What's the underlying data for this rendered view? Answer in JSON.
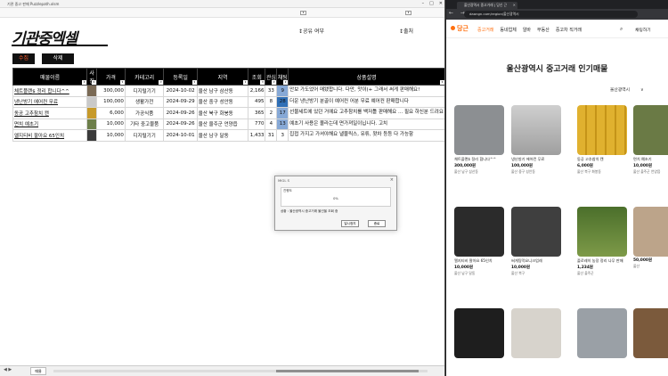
{
  "excel": {
    "title": "기관 중고 판매 Puzzlepath.xlsm",
    "window_buttons": [
      "–",
      "□",
      "✕"
    ],
    "logo": "기관중엑셀",
    "header_left": "↕공유 여부",
    "header_right": "↕출처",
    "btn_fetch": "수집",
    "btn_delete": "삭제",
    "columns": [
      "매물이름",
      "사진",
      "가격",
      "카테고리",
      "등록일",
      "지역",
      "조회",
      "관심",
      "채팅",
      "상품설명"
    ],
    "rows": [
      {
        "name": "체트플랜$ 정리 합니다^^",
        "price": "300,000",
        "category": "디지털기기",
        "date": "2024-10-02",
        "region": "울산 남구 삼산동",
        "views": "2,166",
        "likes": "33",
        "chats": "9",
        "desc": "안보 가도었어 매됐합니다. 다만, 맛이(+ 그래서 써게 판매해요!"
      },
      {
        "name": "냉난방기 에어컨 무료",
        "price": "100,000",
        "category": "생활가전",
        "date": "2024-09-29",
        "region": "울산 중구 성안동",
        "views": "495",
        "likes": "8",
        "chats": "28",
        "desc": "더운 냉난방기 분골이 예어컨 어분 무료 예어컨 판매합니다"
      },
      {
        "name": "동공 고추참치 캔",
        "price": "6,000",
        "category": "가공식품",
        "date": "2024-09-26",
        "region": "울산 북구 화봉동",
        "views": "365",
        "likes": "2",
        "chats": "17",
        "desc": "선물세트에 있던 거예요 고추참치를 백저틀 판매해요 ... 필요 하신분 드려요"
      },
      {
        "name": "면치 예초기",
        "price": "10,000",
        "category": "기타 중고물품",
        "date": "2024-09-26",
        "region": "울산 울주군 언양읍",
        "views": "770",
        "likes": "4",
        "chats": "13",
        "desc": "예초기 사용은 몰라는데 면가져일이닙니다. 고치"
      },
      {
        "name": "엘지티비 팔아요 65인치",
        "price": "10,000",
        "category": "디지털기기",
        "date": "2024-10-01",
        "region": "울산 남구 달동",
        "views": "1,433",
        "likes": "31",
        "chats": "3",
        "desc": "집접 가지고 가셔야해요 낼물릭스, 유튜, 왓차 등등 다 가능함"
      }
    ],
    "dialog": {
      "title": "MIGL S",
      "field_label": "진행도",
      "field_value": "0%",
      "message": "상황 : 울산광역시 중고거래 물건을 조회 중",
      "btn_start": "일시정지",
      "btn_close": "종료"
    },
    "sheet_tab": "매물",
    "nav_arrows": "◀ ▶"
  },
  "browser": {
    "tab_title": "울산광역시 중고거래 | 당신 근",
    "tab_close": "✕",
    "nav_icons": "← → ↻",
    "url": "daangn.com/region/울산광역시",
    "site": {
      "logo": "당근",
      "menu": [
        "중고거래",
        "동네업체",
        "알바",
        "부동산",
        "중고차 직거래"
      ],
      "search_icon": "⌕",
      "login": "채팅하기"
    },
    "page_title": "울산광역시 중고거래 인기매물",
    "region_select": "울산광역시",
    "region_caret": "∨",
    "cards": [
      {
        "title": "체트플랜$ 정리 합니다^^",
        "price": "300,000원",
        "loc": "울산 남구 삼산동",
        "img": "phone"
      },
      {
        "title": "냉난방기 에어컨 무료",
        "price": "100,000원",
        "loc": "울산 중구 성안동",
        "img": "ac"
      },
      {
        "title": "동공 고추참치 캔",
        "price": "6,000원",
        "loc": "울산 북구 화봉동",
        "img": "cans"
      },
      {
        "title": "면치 예초기",
        "price": "10,000원",
        "loc": "울산 울주군 언양읍",
        "img": "tool"
      },
      {
        "title": "엘지티비 팔아요 65인치",
        "price": "10,000원",
        "loc": "울산 남구 달동",
        "img": "tv"
      },
      {
        "title": "써게팅막요니크업레",
        "price": "10,000원",
        "loc": "울산 북구",
        "img": "clothes"
      },
      {
        "title": "플로레히 농장 정리 나무 판매",
        "price": "1,234원",
        "loc": "울산 울주군",
        "img": "tree"
      },
      {
        "title": "",
        "price": "50,000원",
        "loc": "울산",
        "img": "misc"
      },
      {
        "title": "",
        "price": "",
        "loc": "",
        "img": "jacket"
      },
      {
        "title": "",
        "price": "",
        "loc": "",
        "img": "heater"
      },
      {
        "title": "",
        "price": "",
        "loc": "",
        "img": "phone2"
      },
      {
        "title": "",
        "price": "",
        "loc": "",
        "img": "stool"
      }
    ]
  },
  "colors": {
    "accent_orange": "#ff6f0f",
    "header_black": "#000000",
    "link_blue": "#1a3fd0",
    "heat_blue": "#2f6fb6"
  }
}
